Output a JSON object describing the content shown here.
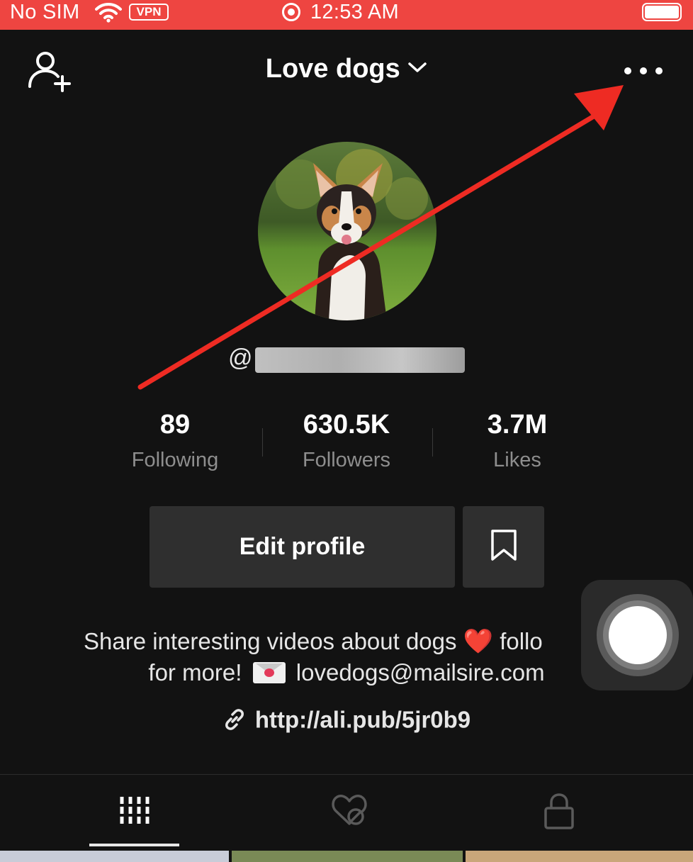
{
  "status_bar": {
    "carrier": "No SIM",
    "vpn": "VPN",
    "time": "12:53 AM"
  },
  "header": {
    "title": "Love dogs",
    "add_user_icon": "add-user-icon",
    "more_icon": "more-dots-icon"
  },
  "profile": {
    "username_prefix": "@",
    "stats": [
      {
        "value": "89",
        "label": "Following"
      },
      {
        "value": "630.5K",
        "label": "Followers"
      },
      {
        "value": "3.7M",
        "label": "Likes"
      }
    ],
    "edit_label": "Edit profile",
    "bio_line1_a": "Share interesting videos about dogs ",
    "bio_line1_heart": "❤️",
    "bio_line1_b": " follo",
    "bio_line2_a": "for more! ",
    "bio_line2_b": " lovedogs@mailsire.com",
    "link": "http://ali.pub/5jr0b9"
  },
  "tabs": [
    {
      "icon": "videos-grid-icon",
      "active": true
    },
    {
      "icon": "liked-hidden-icon",
      "active": false
    },
    {
      "icon": "lock-icon",
      "active": false
    }
  ],
  "colors": {
    "status_bar": "#ee4541",
    "background": "#121212",
    "button": "#2f2f2f",
    "annotation_arrow": "#ee2b23"
  }
}
